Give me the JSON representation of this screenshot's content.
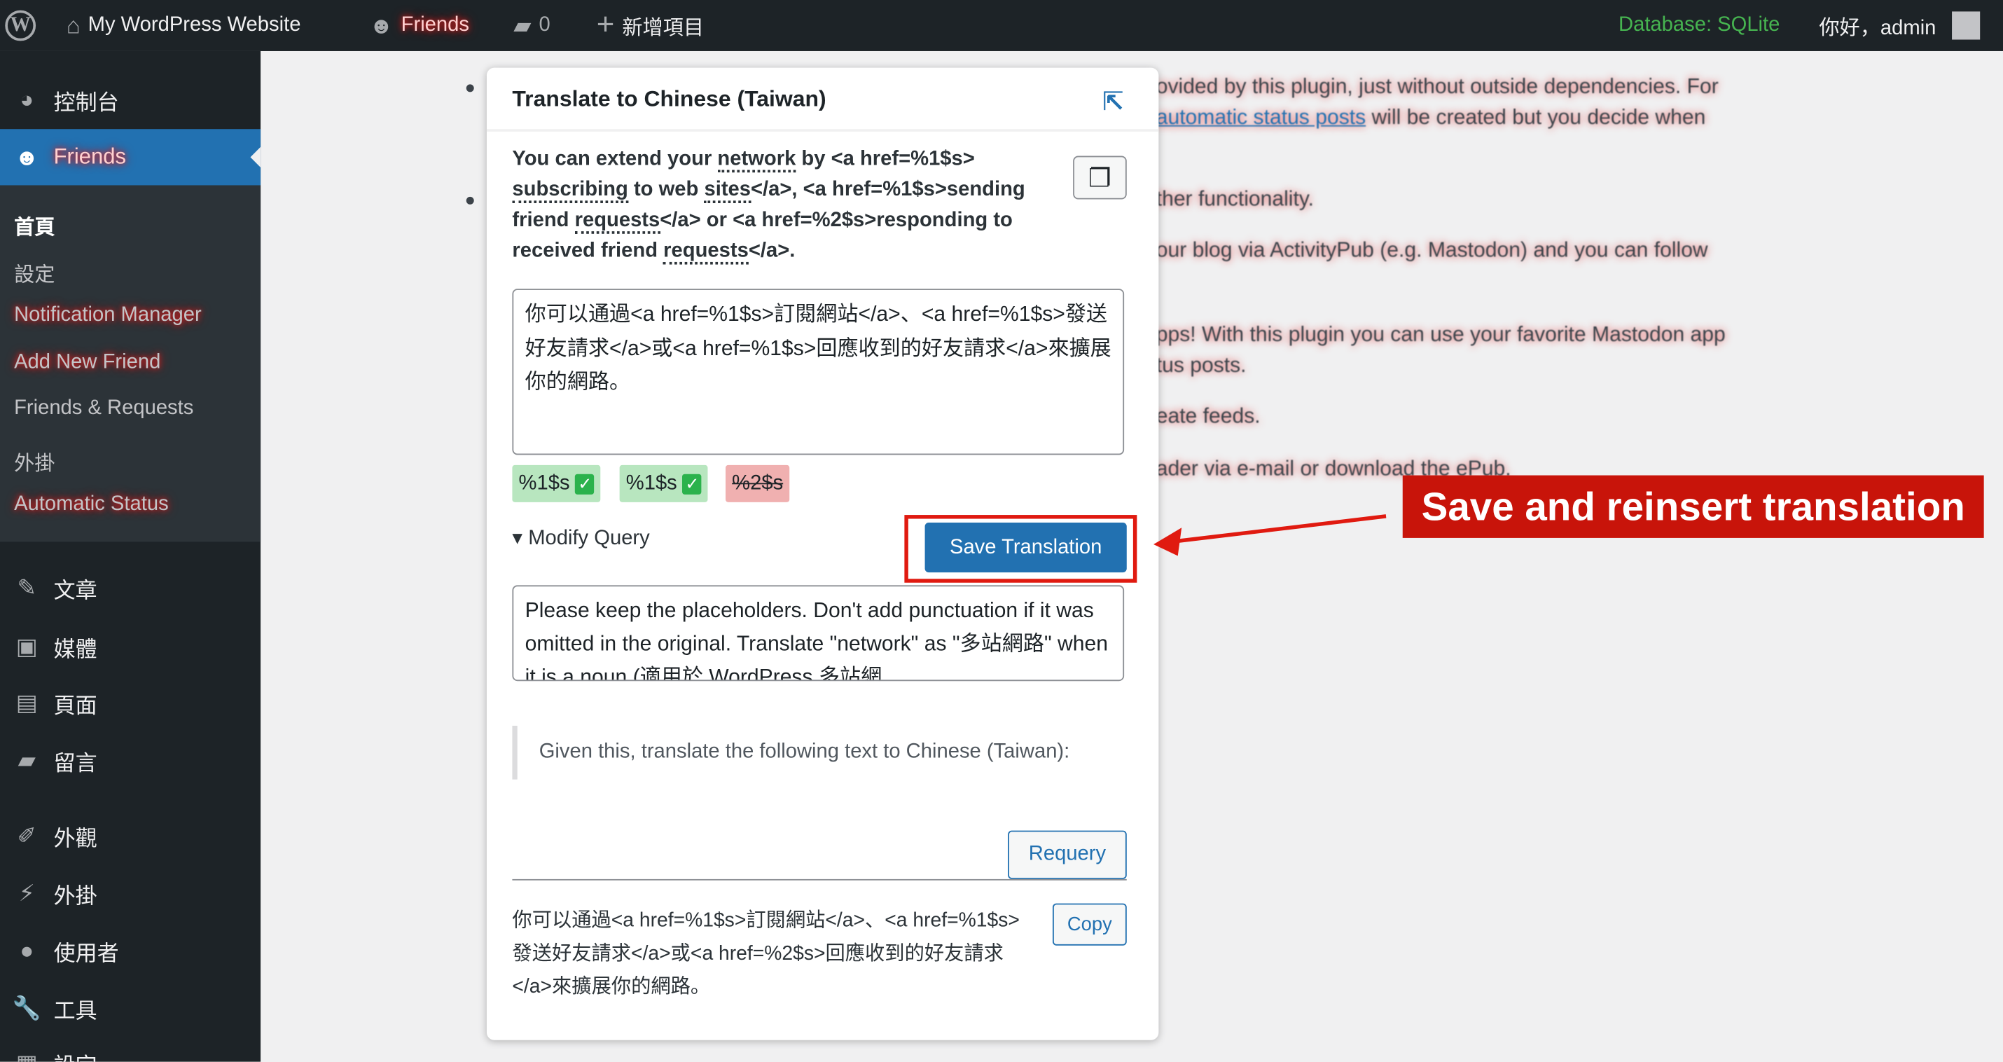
{
  "adminbar": {
    "site_name": "My WordPress Website",
    "friends": "Friends",
    "comments_count": "0",
    "new_item": "新增項目",
    "database": "Database: SQLite",
    "greeting": "你好，admin"
  },
  "sidebar": {
    "items": [
      {
        "label": "控制台",
        "icon": "dashboard-icon"
      },
      {
        "label": "Friends",
        "icon": "friends-icon"
      }
    ],
    "submenu": [
      "首頁",
      "設定",
      "Notification Manager",
      "Add New Friend",
      "Friends & Requests",
      "外掛",
      "Automatic Status"
    ],
    "menu": [
      {
        "label": "文章",
        "icon": "pin-icon"
      },
      {
        "label": "媒體",
        "icon": "media-icon"
      },
      {
        "label": "頁面",
        "icon": "page-icon"
      },
      {
        "label": "留言",
        "icon": "comment-icon"
      },
      {
        "label": "外觀",
        "icon": "brush-icon"
      },
      {
        "label": "外掛",
        "icon": "plugin-icon"
      },
      {
        "label": "使用者",
        "icon": "user-icon"
      },
      {
        "label": "工具",
        "icon": "wrench-icon"
      },
      {
        "label": "設定",
        "icon": "settings-icon"
      }
    ]
  },
  "background_text": {
    "line1": "ovided by this plugin, just without outside dependencies. For",
    "line2_link": "automatic status posts",
    "line2_rest": " will be created but you decide when",
    "line3": "ther functionality.",
    "line4": "our blog via ActivityPub (e.g. Mastodon) and you can follow",
    "line5": "pps! With this plugin you can use your favorite Mastodon app",
    "line6": "tus posts.",
    "line7": "eate feeds.",
    "line8": "ader via e-mail or download the ePub."
  },
  "popup": {
    "title": "Translate to Chinese (Taiwan)",
    "source": {
      "p1": "You can extend your ",
      "w1": "network",
      "p2": " by <a href=%1$s> ",
      "w2": "subscribing",
      "p3": " to web ",
      "w3": "sites",
      "p4": "</a>, <a href=%1$s>sending friend ",
      "w4": "requests",
      "p5": "</a> or <a href=%2$s>responding to received friend ",
      "w5": "requests",
      "p6": "</a>."
    },
    "translation": "你可以通過<a href=%1$s>訂閱網站</a>、<a href=%1$s>發送好友請求</a>或<a href=%1$s>回應收到的好友請求</a>來擴展你的網路。",
    "placeholders": [
      {
        "label": "%1$s",
        "status": "ok"
      },
      {
        "label": "%1$s",
        "status": "ok"
      },
      {
        "label": "%2$s",
        "status": "missing"
      }
    ],
    "modify_query": "Modify Query",
    "save_button": "Save Translation",
    "query": "Please keep the placeholders. Don't add punctuation if it was omitted in the original. Translate \"network\" as \"多站網路\" when it is a noun (適用於 WordPress 多站網",
    "quote": "Given this, translate the following text to Chinese (Taiwan):",
    "requery_button": "Requery",
    "result": "你可以通過<a href=%1$s>訂閱網站</a>、<a href=%1$s>發送好友請求</a>或<a href=%2$s>回應收到的好友請求</a>來擴展你的網路。",
    "copy_button": "Copy"
  },
  "annotation": {
    "label": "Save and reinsert translation",
    "color": "#c8140a"
  },
  "colors": {
    "accent": "#2271b1",
    "ok_chip": "#b8e6bf",
    "missing_chip": "#f0b0b0",
    "database": "#46b450"
  }
}
